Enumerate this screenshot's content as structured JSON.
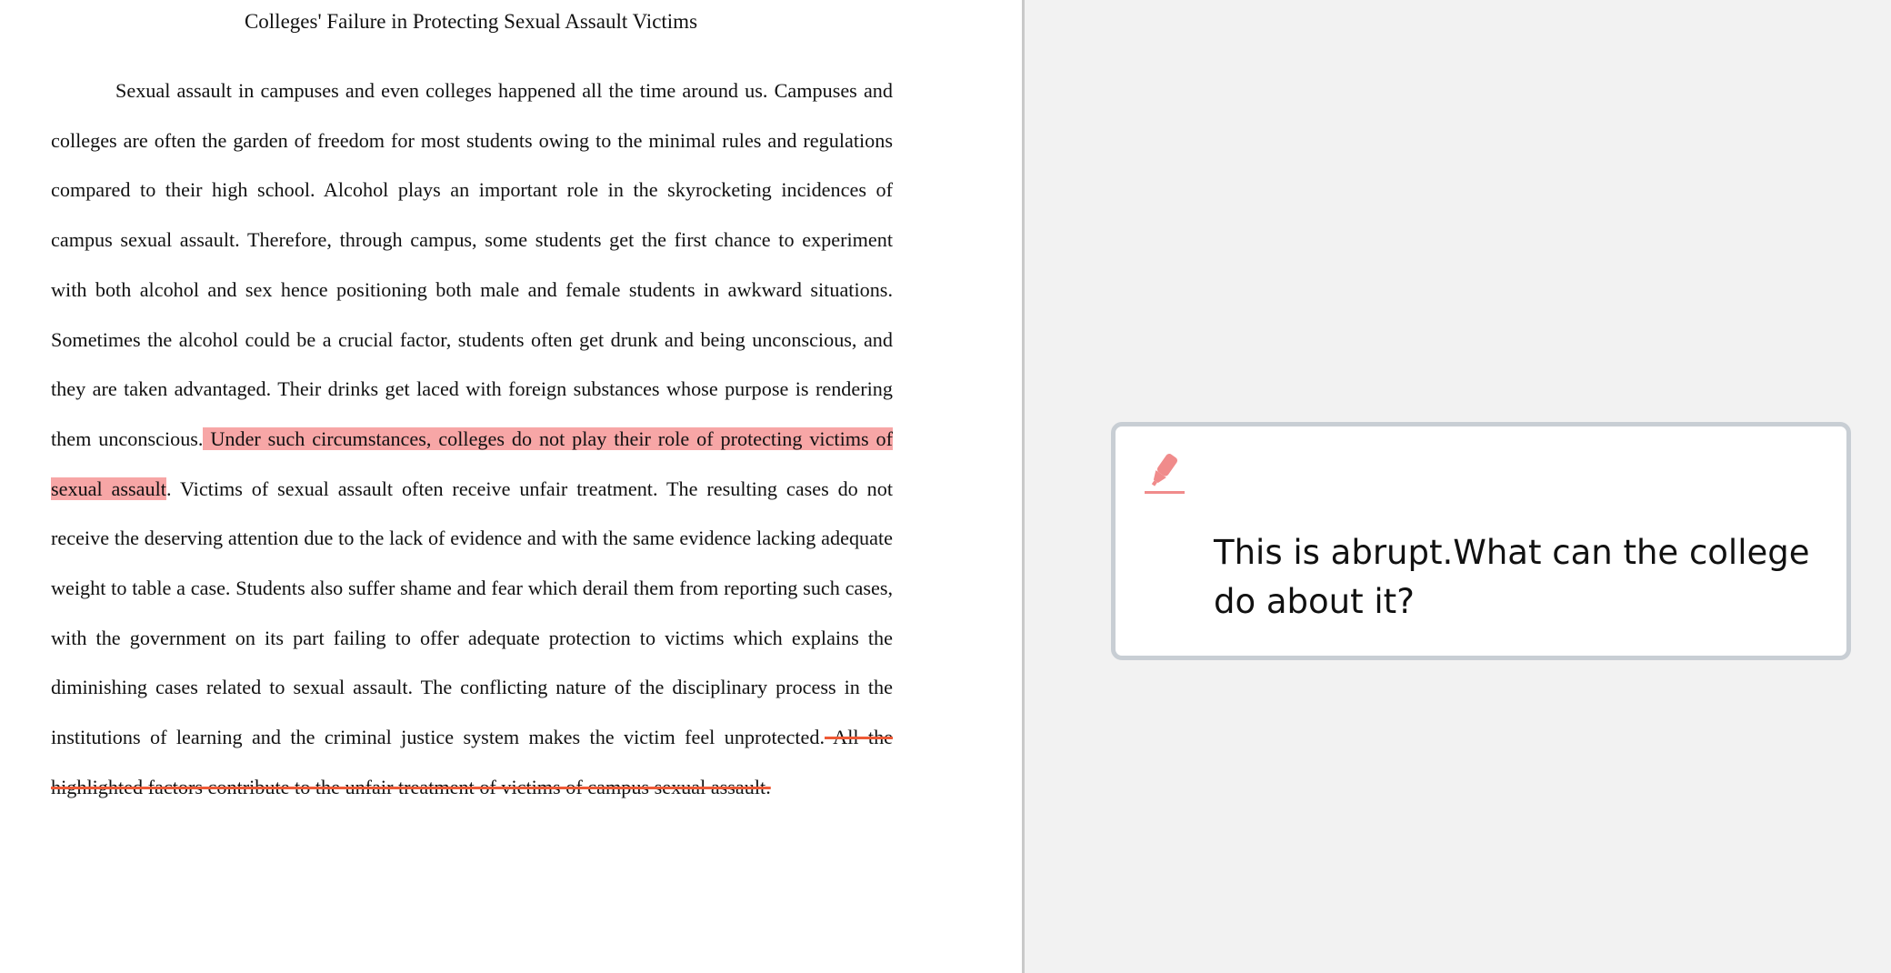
{
  "document": {
    "title": "Colleges' Failure in Protecting Sexual Assault Victims",
    "paragraph": {
      "text_before_highlight": "Sexual assault in campuses and even colleges happened all the time around us. Campuses and colleges are often the garden of freedom for most students owing to the minimal rules and regulations compared to their high school. Alcohol plays an important role in the skyrocketing incidences of campus sexual assault. Therefore, through campus, some students get the first chance to experiment with both alcohol and sex hence positioning both male and female students in awkward situations. Sometimes the alcohol could be a crucial factor, students often get drunk and being unconscious, and they are taken advantaged. Their drinks get laced with foreign substances whose purpose is rendering them unconscious.",
      "highlighted_text": " Under such circumstances, colleges do not play their role of protecting victims of sexual assault",
      "text_between": ". Victims of sexual assault often receive unfair treatment. The resulting cases do not receive the deserving attention due to the lack of evidence and with the same evidence lacking adequate weight to table a case. Students also suffer shame and fear which derail them from reporting such cases, with the government on its part failing to offer adequate protection to victims which explains the diminishing cases related to sexual assault. The conflicting nature of the disciplinary process in the institutions of learning and the criminal justice system makes the victim feel unprotected.",
      "underlined_text": " All the highlighted factors contribute to the unfair treatment of victims of campus sexual assault."
    }
  },
  "annotation": {
    "icon": "highlighter-icon",
    "icon_color": "#f08b8b",
    "comment": "This is abrupt.What can the college do about it?"
  },
  "colors": {
    "highlight": "#f7a6a6",
    "underline": "#ee5a36",
    "card_border": "#c8ced4",
    "divider": "#c9c9c9",
    "right_pane_bg": "#f2f2f2"
  }
}
